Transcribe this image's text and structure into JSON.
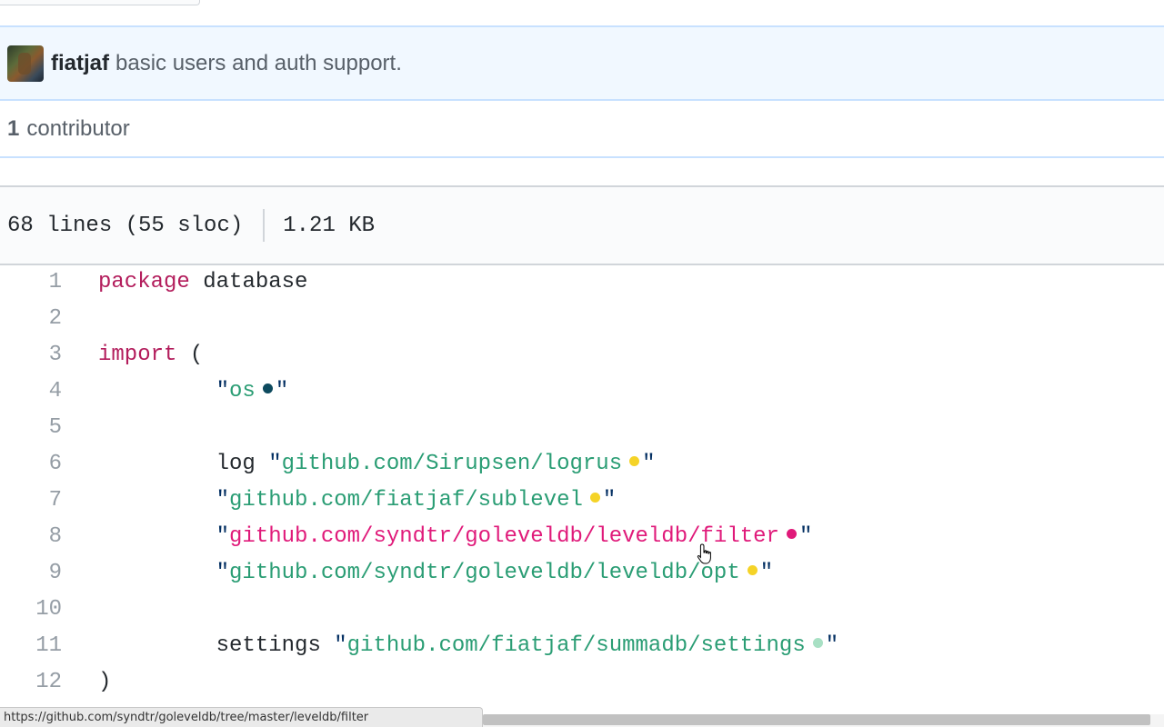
{
  "commit": {
    "author": "fiatjaf",
    "message": "basic users and auth support."
  },
  "contributors": {
    "count": "1",
    "label": "contributor"
  },
  "file": {
    "lines_info": "68 lines (55 sloc)",
    "size": "1.21 KB"
  },
  "code": {
    "lines": [
      {
        "num": "1",
        "parts": [
          {
            "t": "package",
            "c": "kw2"
          },
          {
            "t": " database",
            "c": ""
          }
        ]
      },
      {
        "num": "2",
        "parts": []
      },
      {
        "num": "3",
        "parts": [
          {
            "t": "import",
            "c": "kw2"
          },
          {
            "t": " (",
            "c": ""
          }
        ]
      },
      {
        "num": "4",
        "parts": [
          {
            "t": "\t\"",
            "c": "quote"
          },
          {
            "t": "os",
            "c": "str"
          },
          {
            "dot": "#0d4a5e"
          },
          {
            "t": "\"",
            "c": "quote"
          }
        ]
      },
      {
        "num": "5",
        "parts": []
      },
      {
        "num": "6",
        "parts": [
          {
            "t": "\tlog ",
            "c": ""
          },
          {
            "t": "\"",
            "c": "quote"
          },
          {
            "t": "github.com/Sirupsen/logrus",
            "c": "str"
          },
          {
            "dot": "#f5d327"
          },
          {
            "t": "\"",
            "c": "quote"
          }
        ]
      },
      {
        "num": "7",
        "parts": [
          {
            "t": "\t\"",
            "c": "quote"
          },
          {
            "t": "github.com/fiatjaf/sublevel",
            "c": "str"
          },
          {
            "dot": "#f5d327"
          },
          {
            "t": "\"",
            "c": "quote"
          }
        ]
      },
      {
        "num": "8",
        "parts": [
          {
            "t": "\t\"",
            "c": "quote"
          },
          {
            "t": "github.com/syndtr/goleveldb/leveldb/filter",
            "c": "str-hl"
          },
          {
            "dot": "#e01a7a"
          },
          {
            "t": "\"",
            "c": "quote"
          }
        ]
      },
      {
        "num": "9",
        "parts": [
          {
            "t": "\t\"",
            "c": "quote"
          },
          {
            "t": "github.com/syndtr/goleveldb/leveldb/opt",
            "c": "str"
          },
          {
            "dot": "#f5d327"
          },
          {
            "t": "\"",
            "c": "quote"
          }
        ]
      },
      {
        "num": "10",
        "parts": []
      },
      {
        "num": "11",
        "parts": [
          {
            "t": "\tsettings ",
            "c": ""
          },
          {
            "t": "\"",
            "c": "quote"
          },
          {
            "t": "github.com/fiatjaf/summadb/settings",
            "c": "str"
          },
          {
            "dot": "#a8e0c4"
          },
          {
            "t": "\"",
            "c": "quote"
          }
        ]
      },
      {
        "num": "12",
        "parts": [
          {
            "t": ")",
            "c": ""
          }
        ]
      }
    ]
  },
  "status_bar": {
    "url": "https://github.com/syndtr/goleveldb/tree/master/leveldb/filter"
  }
}
